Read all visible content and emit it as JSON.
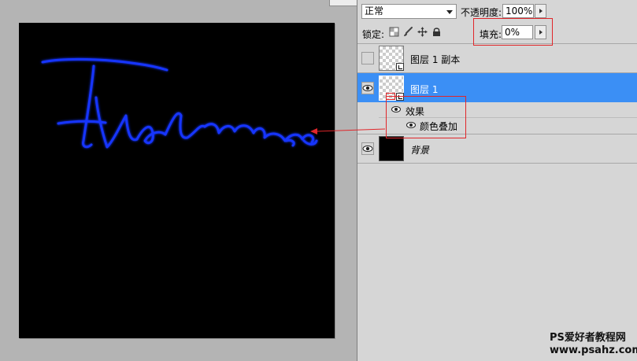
{
  "layers_panel": {
    "blend_mode": "正常",
    "opacity_label": "不透明度:",
    "opacity_value": "100%",
    "lock_label": "锁定:",
    "fill_label": "填充:",
    "fill_value": "0%",
    "layers": [
      {
        "name": "图层 1 副本",
        "visible": false,
        "selected": false,
        "thumb": "transparent"
      },
      {
        "name": "图层 1",
        "visible": true,
        "selected": true,
        "thumb": "transparent"
      },
      {
        "name": "背景",
        "visible": true,
        "selected": false,
        "thumb": "black"
      }
    ],
    "effects": {
      "label": "效果",
      "items": [
        "颜色叠加"
      ]
    }
  },
  "watermark": {
    "line1": "PS爱好者教程网",
    "line2": "www.psahz.com"
  },
  "colors": {
    "selection": "#3b8ff5",
    "highlight": "#e0262a",
    "stroke": "#1535ff",
    "canvas": "#000000",
    "panel": "#d6d6d6"
  },
  "icons": [
    "transparency-lock-icon",
    "brush-lock-icon",
    "move-lock-icon",
    "padlock-icon",
    "eye-icon",
    "smart-object-icon"
  ]
}
